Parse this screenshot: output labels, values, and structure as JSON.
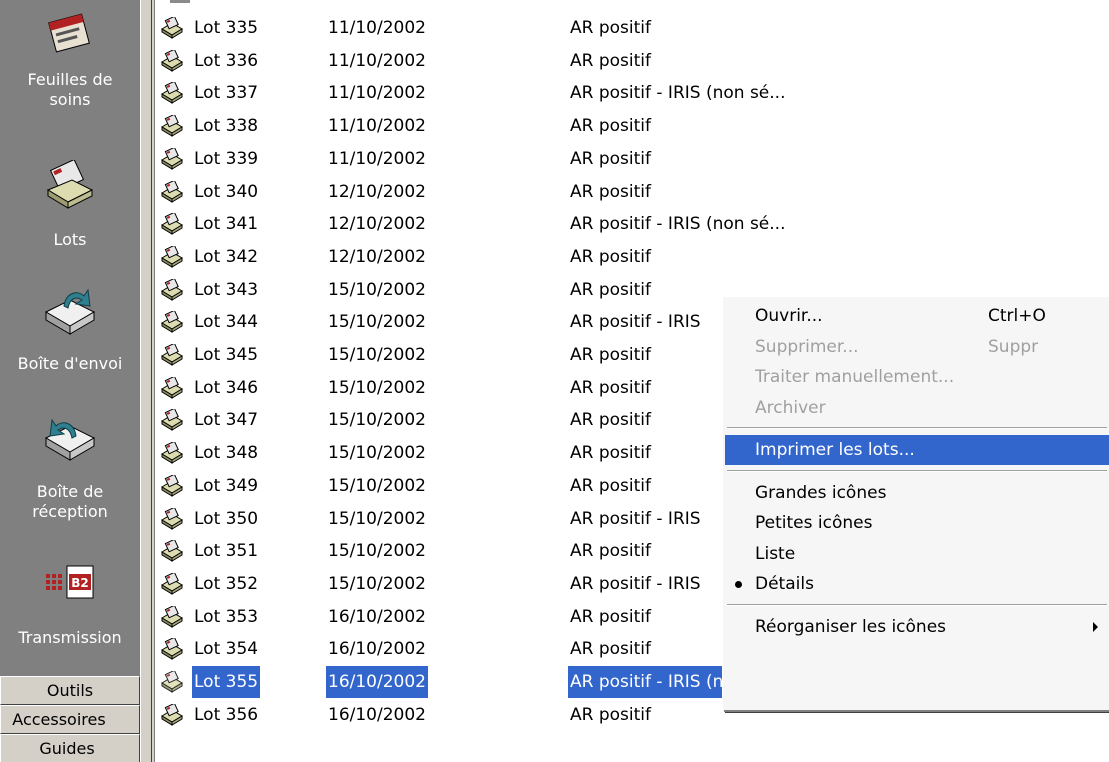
{
  "sidebar": {
    "items": [
      {
        "label": "Feuilles de soins",
        "icon": "treatment-sheets-icon"
      },
      {
        "label": "Lots",
        "icon": "batches-icon"
      },
      {
        "label": "Boîte d'envoi",
        "icon": "outbox-icon"
      },
      {
        "label": "Boîte de réception",
        "icon": "inbox-icon"
      },
      {
        "label": "Transmission",
        "icon": "transmission-b2-icon"
      }
    ],
    "buttons": [
      "Outils",
      "Accessoires",
      "Guides"
    ]
  },
  "rows": [
    {
      "name": "Lot 335",
      "date": "11/10/2002",
      "status": "AR positif"
    },
    {
      "name": "Lot 336",
      "date": "11/10/2002",
      "status": "AR positif"
    },
    {
      "name": "Lot 337",
      "date": "11/10/2002",
      "status": "AR positif - IRIS (non sé..."
    },
    {
      "name": "Lot 338",
      "date": "11/10/2002",
      "status": "AR positif"
    },
    {
      "name": "Lot 339",
      "date": "11/10/2002",
      "status": "AR positif"
    },
    {
      "name": "Lot 340",
      "date": "12/10/2002",
      "status": "AR positif"
    },
    {
      "name": "Lot 341",
      "date": "12/10/2002",
      "status": "AR positif - IRIS (non sé..."
    },
    {
      "name": "Lot 342",
      "date": "12/10/2002",
      "status": "AR positif"
    },
    {
      "name": "Lot 343",
      "date": "15/10/2002",
      "status": "AR positif"
    },
    {
      "name": "Lot 344",
      "date": "15/10/2002",
      "status": "AR positif - IRIS"
    },
    {
      "name": "Lot 345",
      "date": "15/10/2002",
      "status": "AR positif"
    },
    {
      "name": "Lot 346",
      "date": "15/10/2002",
      "status": "AR positif"
    },
    {
      "name": "Lot 347",
      "date": "15/10/2002",
      "status": "AR positif"
    },
    {
      "name": "Lot 348",
      "date": "15/10/2002",
      "status": "AR positif"
    },
    {
      "name": "Lot 349",
      "date": "15/10/2002",
      "status": "AR positif"
    },
    {
      "name": "Lot 350",
      "date": "15/10/2002",
      "status": "AR positif - IRIS"
    },
    {
      "name": "Lot 351",
      "date": "15/10/2002",
      "status": "AR positif"
    },
    {
      "name": "Lot 352",
      "date": "15/10/2002",
      "status": "AR positif - IRIS"
    },
    {
      "name": "Lot 353",
      "date": "16/10/2002",
      "status": "AR positif"
    },
    {
      "name": "Lot 354",
      "date": "16/10/2002",
      "status": "AR positif"
    },
    {
      "name": "Lot 355",
      "date": "16/10/2002",
      "status": "AR positif - IRIS (non sé...",
      "selected": true
    },
    {
      "name": "Lot 356",
      "date": "16/10/2002",
      "status": "AR positif"
    }
  ],
  "context_menu": {
    "items": [
      {
        "label": "Ouvrir...",
        "shortcut": "Ctrl+O"
      },
      {
        "label": "Supprimer...",
        "shortcut": "Suppr",
        "disabled": true
      },
      {
        "label": "Traiter manuellement...",
        "disabled": true
      },
      {
        "label": "Archiver",
        "disabled": true
      },
      {
        "separator": true
      },
      {
        "label": "Imprimer les lots...",
        "highlighted": true
      },
      {
        "separator": true
      },
      {
        "label": "Grandes icônes"
      },
      {
        "label": "Petites icônes"
      },
      {
        "label": "Liste"
      },
      {
        "label": "Détails",
        "checked": true
      },
      {
        "separator": true
      },
      {
        "label": "Réorganiser les icônes",
        "submenu": true
      }
    ]
  },
  "colors": {
    "selection": "#3366cc",
    "sidebar": "#808080",
    "menu_bg": "#f6f6f6",
    "disabled_text": "#a0a0a0"
  }
}
